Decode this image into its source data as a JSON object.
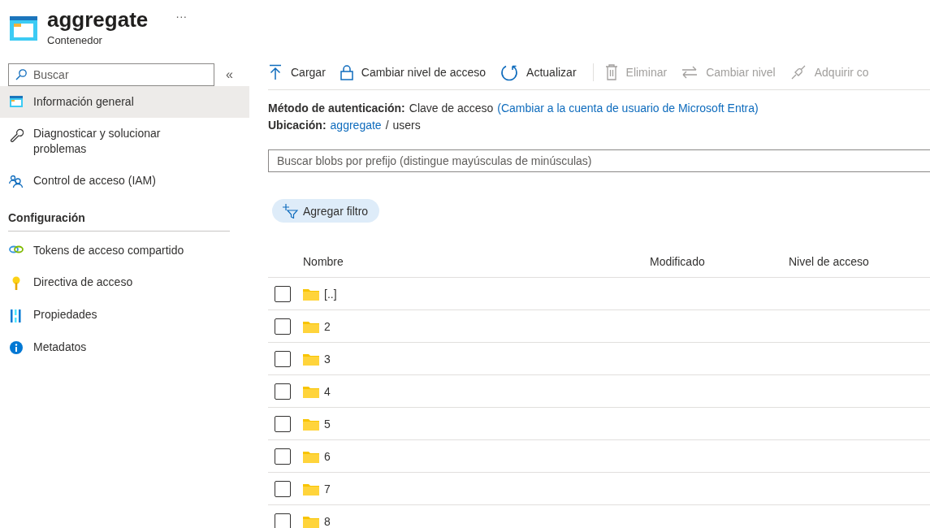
{
  "header": {
    "title": "aggregate",
    "subtitle": "Contenedor",
    "more": "···"
  },
  "sidebar": {
    "search": {
      "placeholder": "Buscar"
    },
    "collapse": "«",
    "items": [
      {
        "kind": "overview",
        "label": "Información general",
        "selected": true
      },
      {
        "kind": "wrench",
        "label": "Diagnosticar y solucionar problemas",
        "selected": false
      },
      {
        "kind": "people",
        "label": "Control de acceso (IAM)",
        "selected": false
      }
    ],
    "sections": [
      {
        "heading": "Configuración",
        "items": [
          {
            "kind": "link",
            "label": "Tokens de acceso compartido",
            "selected": false
          },
          {
            "kind": "key",
            "label": "Directiva de acceso",
            "selected": false
          },
          {
            "kind": "bars",
            "label": "Propiedades",
            "selected": false
          },
          {
            "kind": "info",
            "label": "Metadatos",
            "selected": false
          }
        ]
      }
    ]
  },
  "toolbar": [
    {
      "kind": "upload",
      "label": "Cargar",
      "disabled": false
    },
    {
      "kind": "lock",
      "label": "Cambiar nivel de acceso",
      "disabled": false
    },
    {
      "kind": "refresh",
      "label": "Actualizar",
      "disabled": false
    },
    {
      "kind": "trash",
      "label": "Eliminar",
      "disabled": true,
      "separator_before": true
    },
    {
      "kind": "swap",
      "label": "Cambiar nivel",
      "disabled": true
    },
    {
      "kind": "unlink",
      "label": "Adquirir co",
      "disabled": true
    }
  ],
  "auth": {
    "label": "Método de autenticación:",
    "value": "Clave de acceso",
    "link": "(Cambiar a la cuenta de usuario de Microsoft Entra)"
  },
  "location": {
    "label": "Ubicación:",
    "link": "aggregate",
    "separator": "/",
    "path": "users"
  },
  "blob_search": {
    "placeholder": "Buscar blobs por prefijo (distingue mayúsculas de minúsculas)"
  },
  "filter_button": "Agregar filtro",
  "table": {
    "columns": [
      "Nombre",
      "Modificado",
      "Nivel de acceso"
    ],
    "rows": [
      {
        "name": "[..]",
        "checked": false
      },
      {
        "name": "2",
        "checked": false
      },
      {
        "name": "3",
        "checked": false
      },
      {
        "name": "4",
        "checked": false
      },
      {
        "name": "5",
        "checked": false
      },
      {
        "name": "6",
        "checked": false
      },
      {
        "name": "7",
        "checked": false
      },
      {
        "name": "8",
        "checked": false
      }
    ]
  }
}
